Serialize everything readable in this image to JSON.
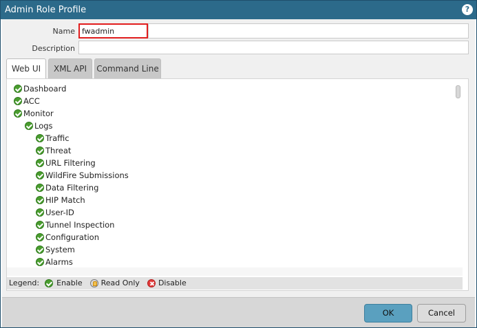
{
  "dialog": {
    "title": "Admin Role Profile",
    "help_icon": "?"
  },
  "form": {
    "name_label": "Name",
    "name_value": "fwadmin",
    "description_label": "Description",
    "description_value": ""
  },
  "tabs": [
    {
      "label": "Web UI",
      "active": true
    },
    {
      "label": "XML API",
      "active": false
    },
    {
      "label": "Command Line",
      "active": false
    }
  ],
  "tree": {
    "items": [
      {
        "label": "Dashboard",
        "level": 0,
        "state": "enable"
      },
      {
        "label": "ACC",
        "level": 0,
        "state": "enable"
      },
      {
        "label": "Monitor",
        "level": 0,
        "state": "enable"
      },
      {
        "label": "Logs",
        "level": 1,
        "state": "enable"
      },
      {
        "label": "Traffic",
        "level": 2,
        "state": "enable"
      },
      {
        "label": "Threat",
        "level": 2,
        "state": "enable"
      },
      {
        "label": "URL Filtering",
        "level": 2,
        "state": "enable"
      },
      {
        "label": "WildFire Submissions",
        "level": 2,
        "state": "enable"
      },
      {
        "label": "Data Filtering",
        "level": 2,
        "state": "enable"
      },
      {
        "label": "HIP Match",
        "level": 2,
        "state": "enable"
      },
      {
        "label": "User-ID",
        "level": 2,
        "state": "enable"
      },
      {
        "label": "Tunnel Inspection",
        "level": 2,
        "state": "enable"
      },
      {
        "label": "Configuration",
        "level": 2,
        "state": "enable"
      },
      {
        "label": "System",
        "level": 2,
        "state": "enable"
      },
      {
        "label": "Alarms",
        "level": 2,
        "state": "enable"
      }
    ]
  },
  "legend": {
    "title": "Legend:",
    "enable": "Enable",
    "read_only": "Read Only",
    "disable": "Disable"
  },
  "buttons": {
    "ok": "OK",
    "cancel": "Cancel"
  },
  "colors": {
    "titlebar": "#2c6a8a",
    "enable_green": "#4a9d2f",
    "ok_button": "#5aa0bf",
    "name_highlight": "#e11c1c"
  }
}
